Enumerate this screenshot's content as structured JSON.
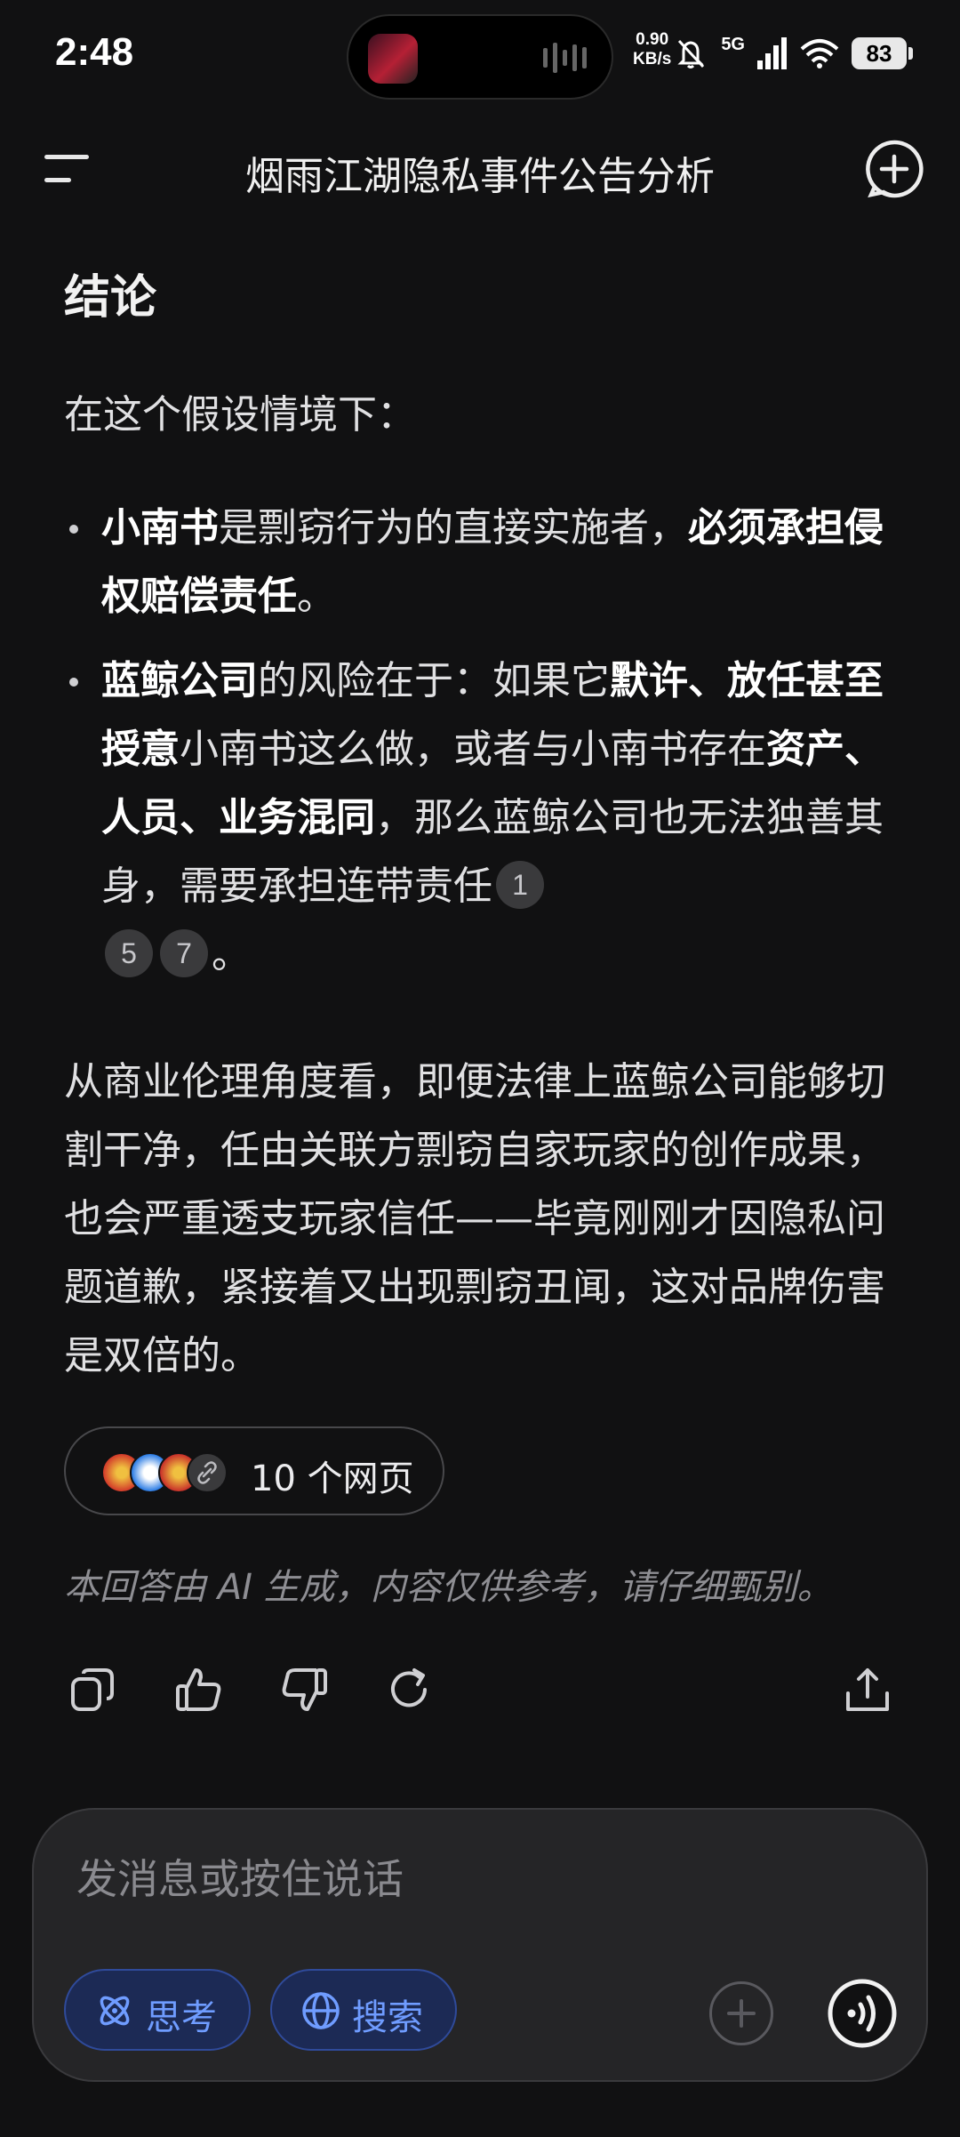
{
  "status_bar": {
    "time": "2:48",
    "net_speed_value": "0.90",
    "net_speed_unit": "KB/s",
    "network": "5G",
    "battery": "83"
  },
  "header": {
    "title": "烟雨江湖隐私事件公告分析"
  },
  "message": {
    "heading": "结论",
    "intro": "在这个假设情境下：",
    "bullets": [
      {
        "bold_1": "小南书",
        "text_1": "是剽窃行为的直接实施者，",
        "bold_2": "必须承担侵权赔偿责任",
        "text_2": "。"
      },
      {
        "bold_1": "蓝鲸公司",
        "text_1": "的风险在于：如果它",
        "bold_2": "默许、放任甚至授意",
        "text_2": "小南书这么做，或者与小南书存在",
        "bold_3": "资产、人员、业务混同",
        "text_3": "，那么蓝鲸公司也无法独善其身，需要承担连带责任",
        "citations": [
          "1",
          "5",
          "7"
        ],
        "text_4": "。"
      }
    ],
    "paragraph": "从商业伦理角度看，即便法律上蓝鲸公司能够切割干净，任由关联方剽窃自家玩家的创作成果，也会严重透支玩家信任——毕竟刚刚才因隐私问题道歉，紧接着又出现剽窃丑闻，这对品牌伤害是双倍的。",
    "sources_label": "10 个网页",
    "disclaimer": "本回答由 AI 生成，内容仅供参考，请仔细甄别。"
  },
  "composer": {
    "placeholder": "发消息或按住说话",
    "think_label": "思考",
    "search_label": "搜索"
  },
  "colors": {
    "background": "#111112",
    "accent_blue": "#6f9cff",
    "chip_bg": "#1c2a55"
  }
}
